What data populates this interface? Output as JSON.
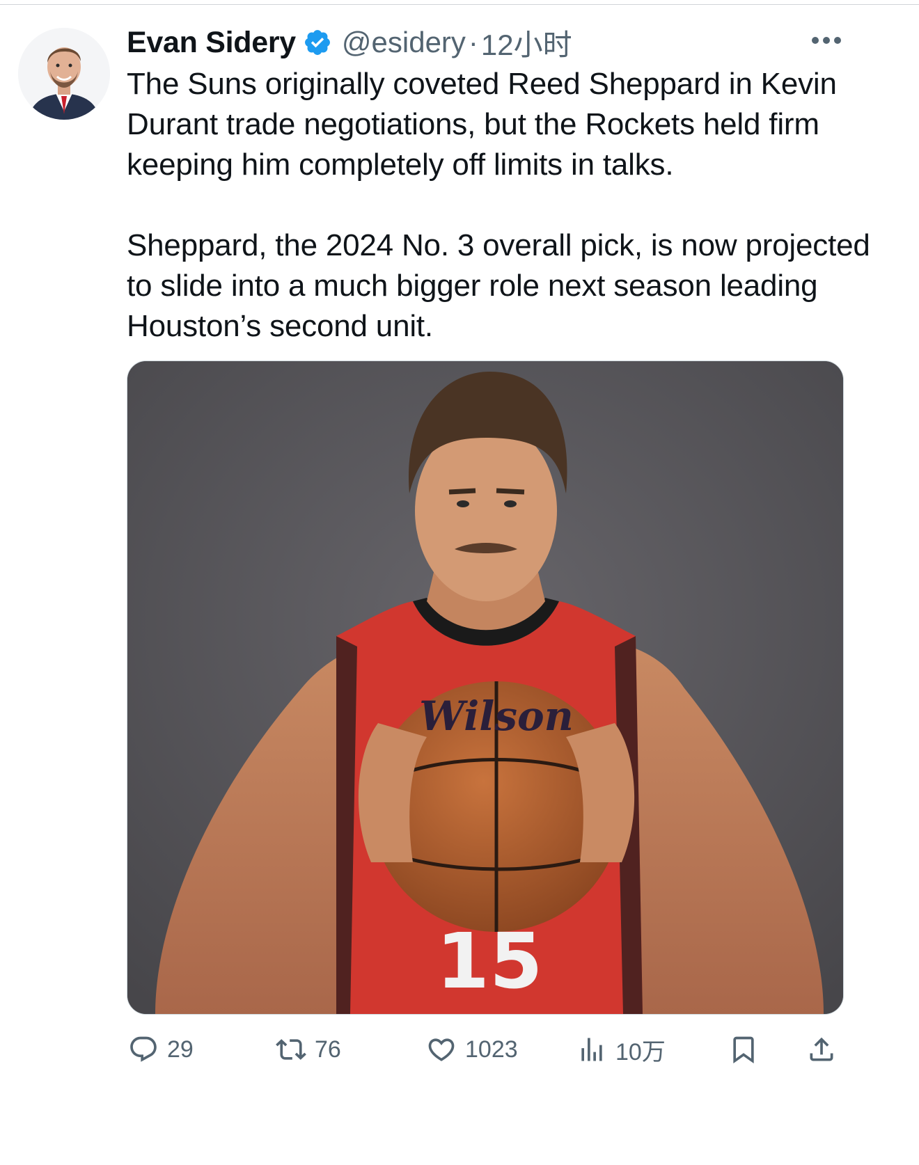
{
  "author": {
    "display_name": "Evan Sidery",
    "handle": "@esidery",
    "separator": "·",
    "time": "12小时",
    "verified": true,
    "avatar_icon": "avatar"
  },
  "tweet": {
    "paragraphs": [
      "The Suns originally coveted Reed Sheppard in Kevin Durant trade negotiations, but the Rockets held firm keeping him completely off limits in talks.",
      "Sheppard, the 2024 No. 3 overall pick, is now projected to slide into a much bigger role next season leading Houston’s second unit."
    ]
  },
  "media": {
    "jersey_number": "15",
    "ball_brand": "Wilson"
  },
  "actions": {
    "reply_count": "29",
    "retweet_count": "76",
    "like_count": "1023",
    "view_count": "10万"
  },
  "colors": {
    "text_primary": "#0f1419",
    "text_secondary": "#536471",
    "verified_blue": "#1d9bf0",
    "jersey_red": "#d1372f",
    "backdrop": "#555356"
  }
}
